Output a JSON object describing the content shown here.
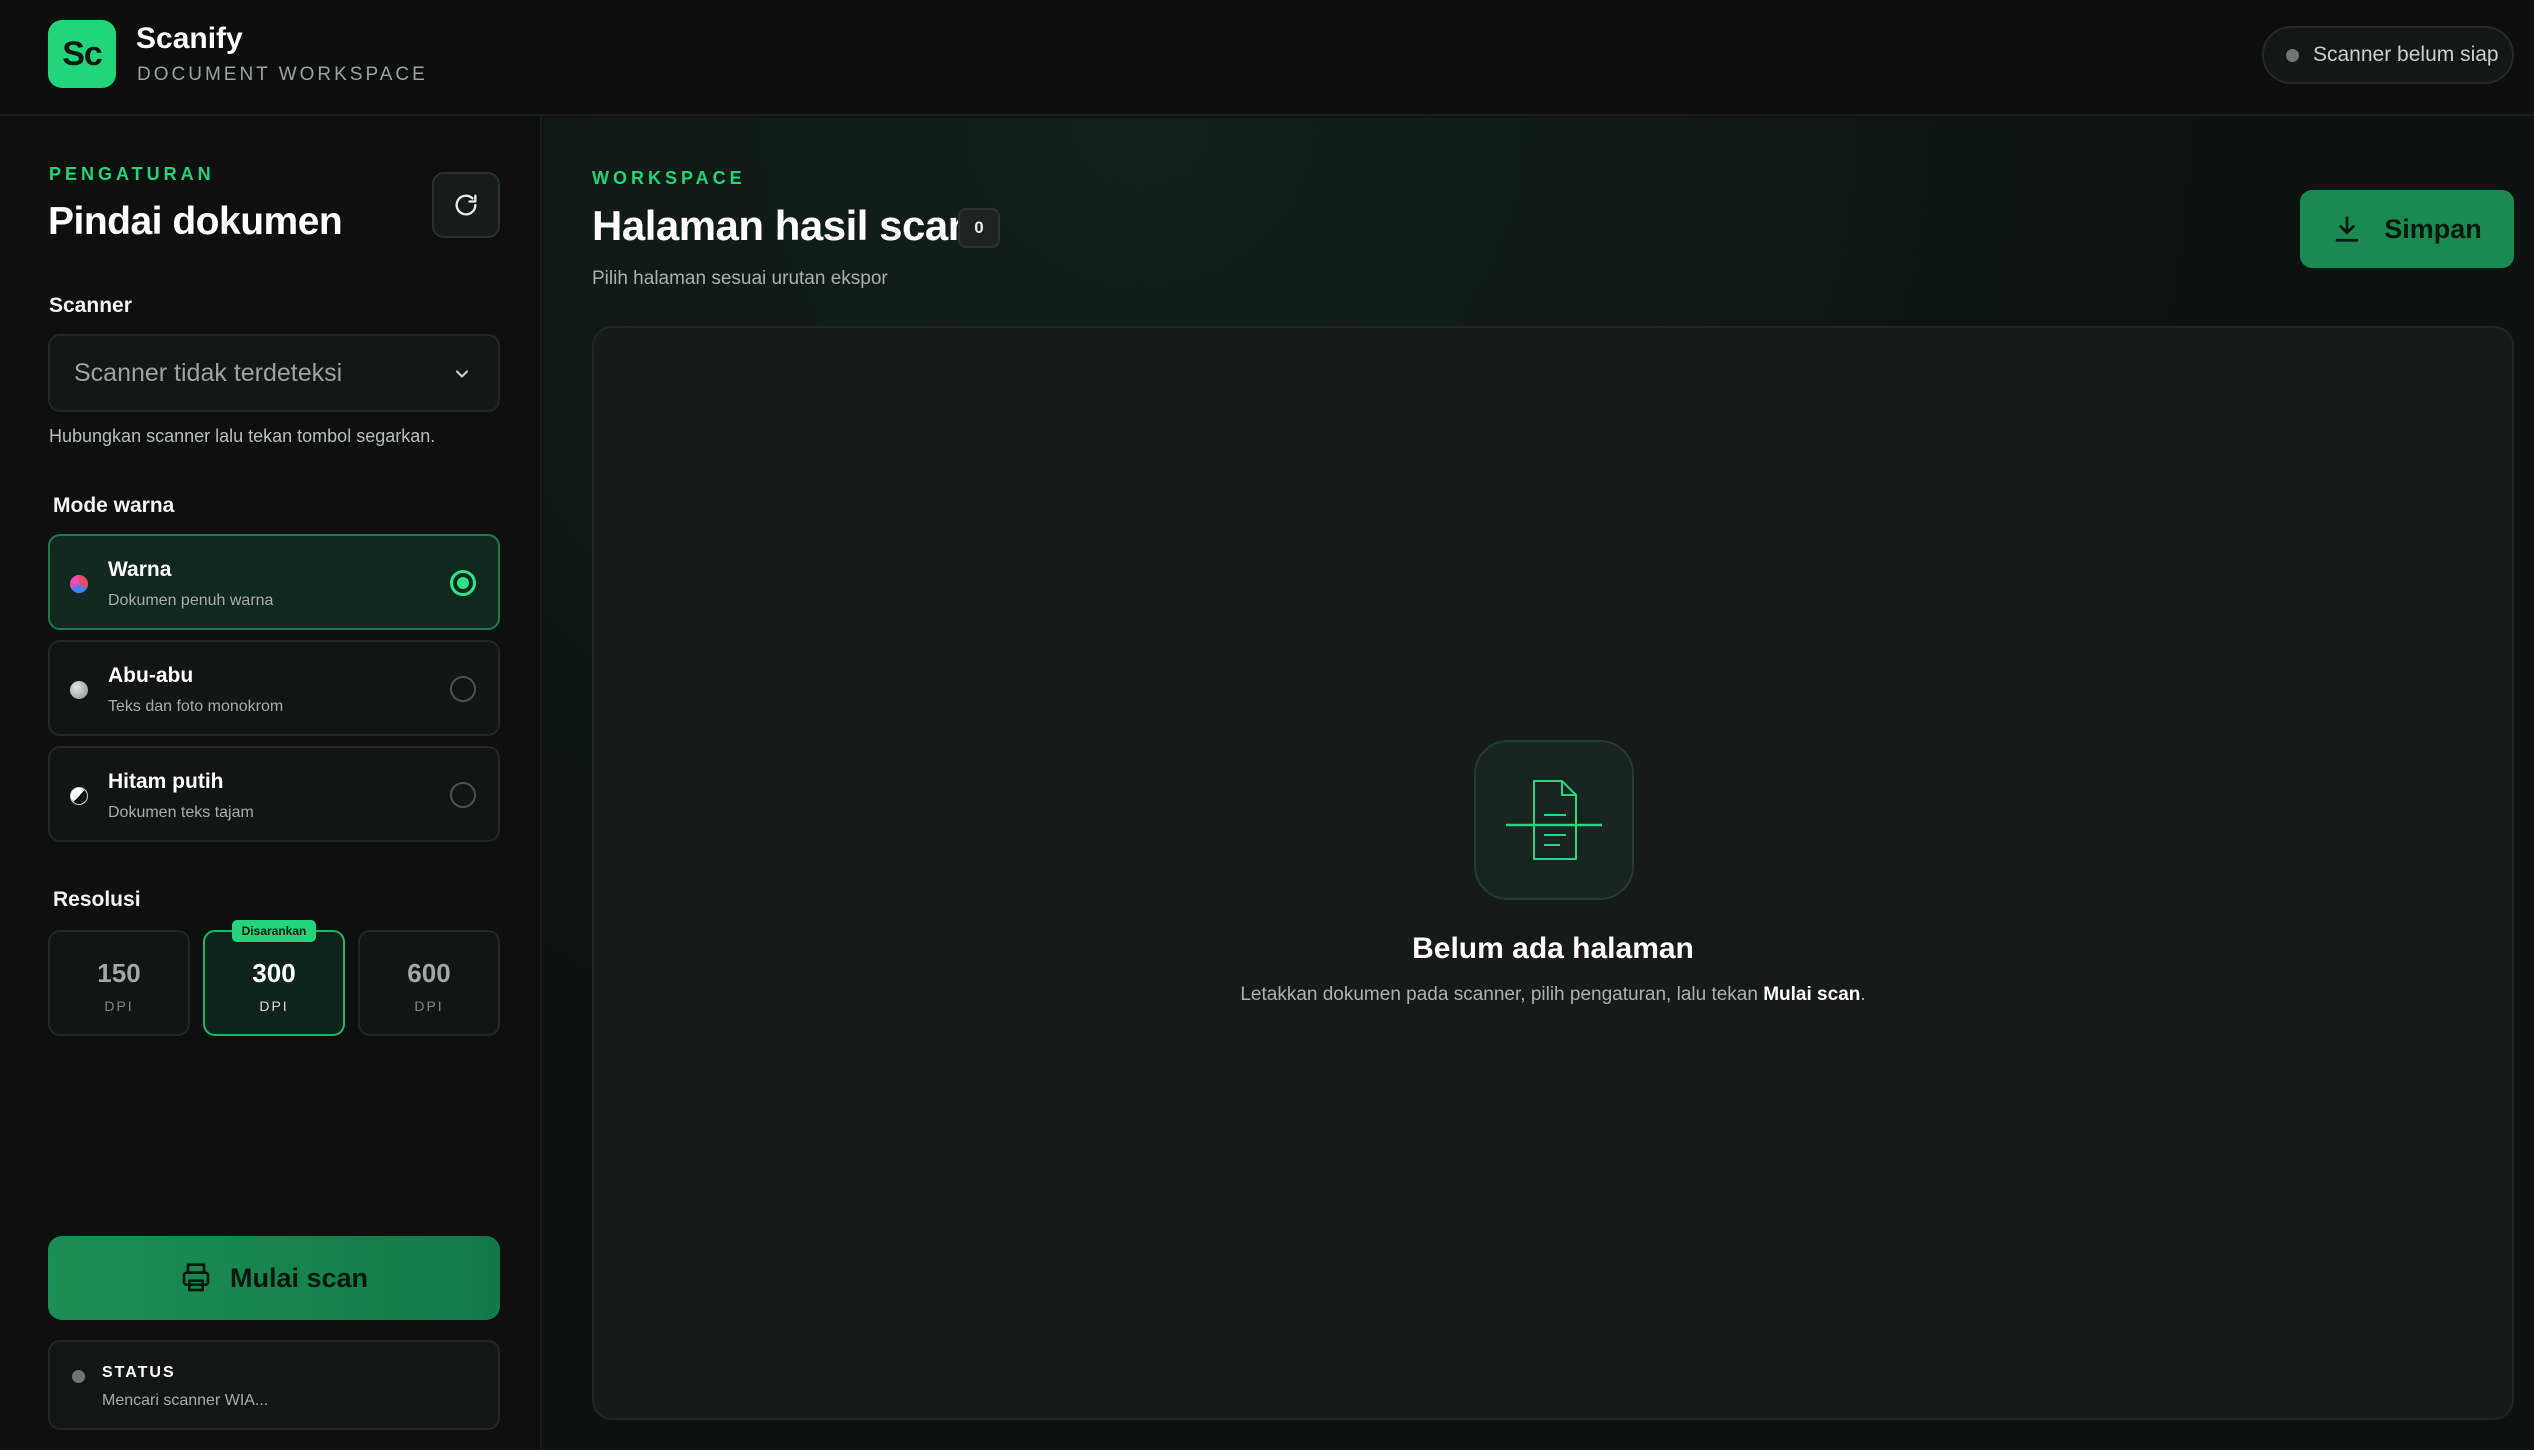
{
  "app": {
    "logo_text": "Sc",
    "name": "Scanify",
    "subtitle": "DOCUMENT WORKSPACE",
    "scanner_status": "Scanner belum siap"
  },
  "sidebar": {
    "eyebrow": "PENGATURAN",
    "title": "Pindai dokumen",
    "scanner_label": "Scanner",
    "scanner_select_value": "Scanner tidak terdeteksi",
    "scanner_hint": "Hubungkan scanner lalu tekan tombol segarkan.",
    "mode_label": "Mode warna",
    "modes": [
      {
        "title": "Warna",
        "subtitle": "Dokumen penuh warna",
        "selected": true
      },
      {
        "title": "Abu-abu",
        "subtitle": "Teks dan foto monokrom",
        "selected": false
      },
      {
        "title": "Hitam putih",
        "subtitle": "Dokumen teks tajam",
        "selected": false
      }
    ],
    "resolution_label": "Resolusi",
    "resolutions": [
      {
        "value": "150",
        "unit": "DPI",
        "selected": false
      },
      {
        "value": "300",
        "unit": "DPI",
        "selected": true
      },
      {
        "value": "600",
        "unit": "DPI",
        "selected": false
      }
    ],
    "recommended_badge": "Disarankan",
    "scan_button": "Mulai scan",
    "status_title": "STATUS",
    "status_message": "Mencari scanner WIA..."
  },
  "main": {
    "eyebrow": "WORKSPACE",
    "title": "Halaman hasil scan",
    "page_count": "0",
    "subtitle": "Pilih halaman sesuai urutan ekspor",
    "save_button": "Simpan",
    "empty_title": "Belum ada halaman",
    "empty_text_before": "Letakkan dokumen pada scanner, pilih pengaturan, lalu tekan ",
    "empty_text_bold": "Mulai scan",
    "empty_text_after": "."
  },
  "colors": {
    "accent": "#22d47a",
    "background": "#0d1311",
    "panel": "#141b19"
  },
  "icons": {
    "refresh": "refresh-icon",
    "chevron": "chevron-down-icon",
    "scan": "printer-icon",
    "save": "download-icon",
    "empty": "document-scan-icon"
  }
}
